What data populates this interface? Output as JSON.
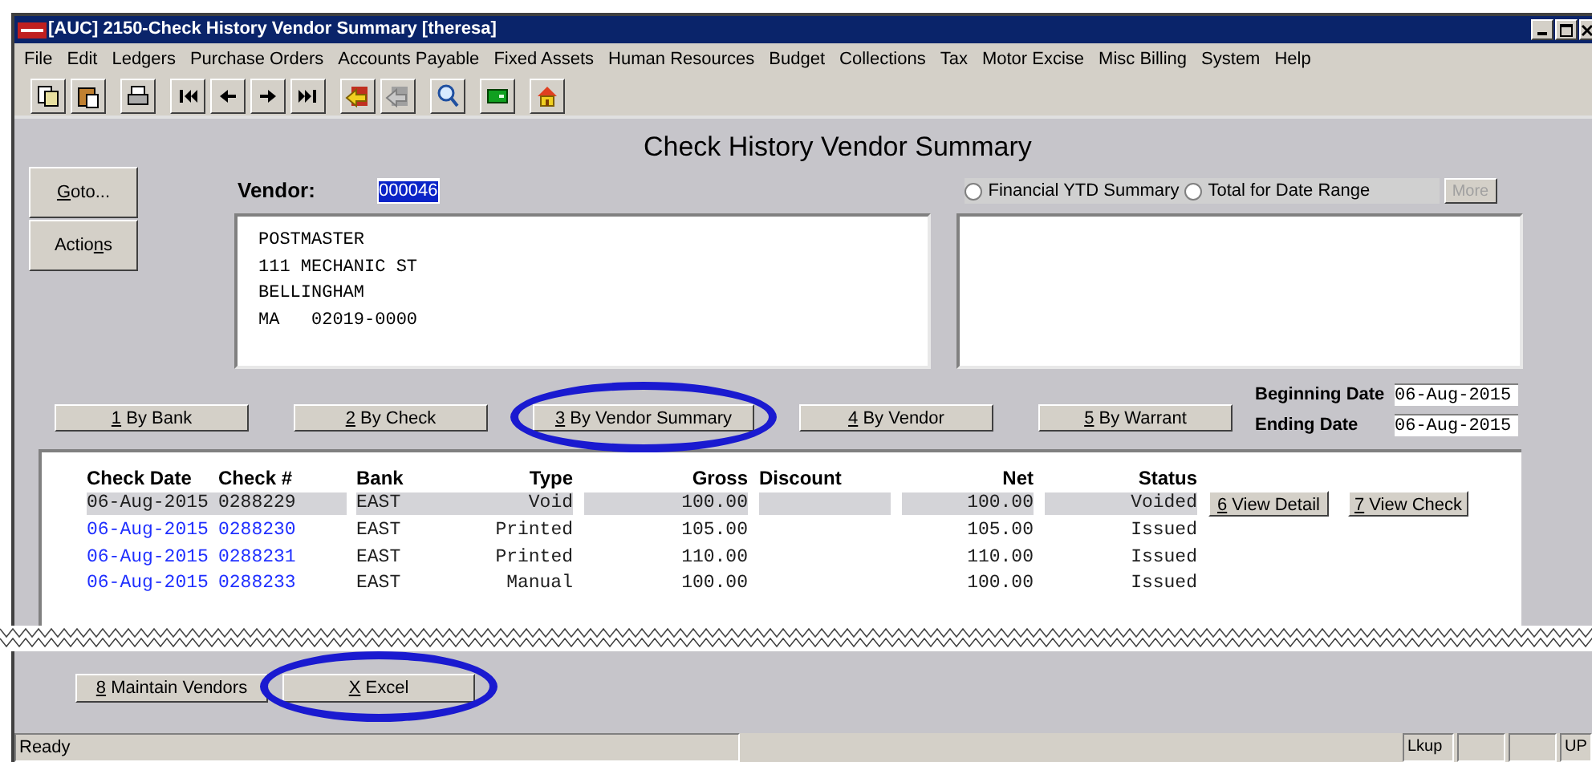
{
  "window": {
    "title": "[AUC] 2150-Check History Vendor Summary [theresa]"
  },
  "menu": [
    "File",
    "Edit",
    "Ledgers",
    "Purchase Orders",
    "Accounts Payable",
    "Fixed Assets",
    "Human Resources",
    "Budget",
    "Collections",
    "Tax",
    "Motor Excise",
    "Misc Billing",
    "System",
    "Help"
  ],
  "toolbar": [
    {
      "kind": "copy"
    },
    {
      "kind": "paste"
    },
    {
      "kind": "print"
    },
    {
      "kind": "first"
    },
    {
      "kind": "prev"
    },
    {
      "kind": "next"
    },
    {
      "kind": "last"
    },
    {
      "kind": "exit"
    },
    {
      "kind": "exit-disabled"
    },
    {
      "kind": "search"
    },
    {
      "kind": "screen"
    },
    {
      "kind": "home"
    }
  ],
  "side_buttons": [
    {
      "mnemonic": "G",
      "after": "oto..."
    },
    {
      "before": "Actio",
      "mnemonic": "n",
      "after": "s"
    }
  ],
  "heading": "Check History Vendor Summary",
  "vendor": {
    "label": "Vendor:",
    "value": "000046"
  },
  "address": [
    "POSTMASTER",
    "111 MECHANIC ST",
    "BELLINGHAM",
    "MA   02019-0000"
  ],
  "summary_options": [
    {
      "label": "Financial YTD Summary",
      "selected": false
    },
    {
      "label": "Total for Date Range",
      "selected": false
    }
  ],
  "more_button": {
    "label": "More",
    "disabled": true
  },
  "view_buttons": [
    {
      "mnemonic": "1",
      "after": " By Bank",
      "highlighted": false
    },
    {
      "mnemonic": "2",
      "after": " By Check",
      "highlighted": false
    },
    {
      "mnemonic": "3",
      "after": " By Vendor Summary",
      "highlighted": true
    },
    {
      "mnemonic": "4",
      "after": " By Vendor",
      "highlighted": false
    },
    {
      "mnemonic": "5",
      "after": " By Warrant",
      "highlighted": false
    }
  ],
  "dates": [
    {
      "label": "Beginning Date",
      "value": "06-Aug-2015"
    },
    {
      "label": "Ending Date",
      "value": "06-Aug-2015"
    }
  ],
  "table": {
    "columns": [
      "Check Date",
      "Check #",
      "Bank",
      "Type",
      "Gross",
      "Discount",
      "Net",
      "Status"
    ],
    "rows": [
      {
        "selected": true,
        "cells": [
          "06-Aug-2015",
          "0288229",
          "EAST",
          "Void",
          "100.00",
          null,
          "100.00",
          "Voided"
        ]
      },
      {
        "selected": false,
        "cells": [
          "06-Aug-2015",
          "0288230",
          "EAST",
          "Printed",
          "105.00",
          null,
          "105.00",
          "Issued"
        ]
      },
      {
        "selected": false,
        "cells": [
          "06-Aug-2015",
          "0288231",
          "EAST",
          "Printed",
          "110.00",
          null,
          "110.00",
          "Issued"
        ]
      },
      {
        "selected": false,
        "cells": [
          "06-Aug-2015",
          "0288233",
          "EAST",
          "Manual",
          "100.00",
          null,
          "100.00",
          "Issued"
        ]
      }
    ],
    "row_actions": [
      {
        "mnemonic": "6",
        "after": " View Detail"
      },
      {
        "mnemonic": "7",
        "after": " View Check"
      }
    ]
  },
  "bottom_buttons": [
    {
      "mnemonic": "8",
      "after": " Maintain Vendors",
      "highlighted": false
    },
    {
      "mnemonic": "X",
      "after": " Excel",
      "highlighted": true
    }
  ],
  "status_bar": {
    "message": "Ready",
    "indicators": [
      "Lkup",
      "UP"
    ]
  }
}
